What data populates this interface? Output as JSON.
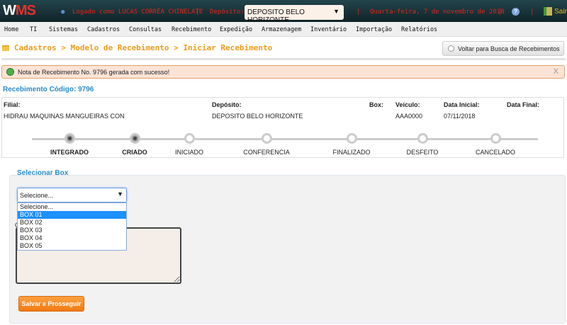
{
  "header": {
    "logo": "WMS",
    "user": "Logado como LUCAS CORRÊA CHINELATE",
    "sep": "|",
    "deposito_label": "Depósito:",
    "deposito_value": "DEPOSITO BELO HORIZONTE",
    "date": "Quarta-feira, 7 de novembro de 2018",
    "help": "?",
    "logout": "Sair"
  },
  "nav": [
    "Home",
    "TI",
    "Sistemas",
    "Cadastros",
    "Consultas",
    "Recebimento",
    "Expedição",
    "Armazenagem",
    "Inventário",
    "Importação",
    "Relatórios"
  ],
  "breadcrumb": "Cadastros > Modelo de Recebimento > Iniciar Recebimento",
  "back_button": "Voltar para Busca de Recebimentos",
  "alert": {
    "message": "Nota de Recebimento No. 9796 gerada com sucesso!",
    "close": "X"
  },
  "codigo": "Recebimento Código: 9796",
  "info": {
    "filial_label": "Filial:",
    "filial": "HIDRAU MAQUINAS MANGUEIRAS CON",
    "deposito_label": "Depósito:",
    "deposito": "DEPOSITO BELO HORIZONTE",
    "box_label": "Box:",
    "veiculo_label": "Veículo:",
    "veiculo": "AAA0000",
    "data_inicial_label": "Data Inicial:",
    "data_inicial": "07/11/2018",
    "data_final_label": "Data Final:"
  },
  "steps": [
    {
      "label": "INTEGRADO",
      "done": true
    },
    {
      "label": "CRIADO",
      "done": true
    },
    {
      "label": "INICIADO",
      "done": false
    },
    {
      "label": "CONFERENCIA",
      "done": false
    },
    {
      "label": "FINALIZADO",
      "done": false
    },
    {
      "label": "DESFEITO",
      "done": false
    },
    {
      "label": "CANCELADO",
      "done": false
    }
  ],
  "form": {
    "legend": "Selecionar Box",
    "select_value": "Selecione...",
    "options": [
      "Selecione...",
      "BOX 01",
      "BOX 02",
      "BOX 03",
      "BOX 04",
      "BOX 05"
    ],
    "highlighted": "BOX 01",
    "obs_label": "O",
    "submit": "Salvar e Prosseguir"
  }
}
